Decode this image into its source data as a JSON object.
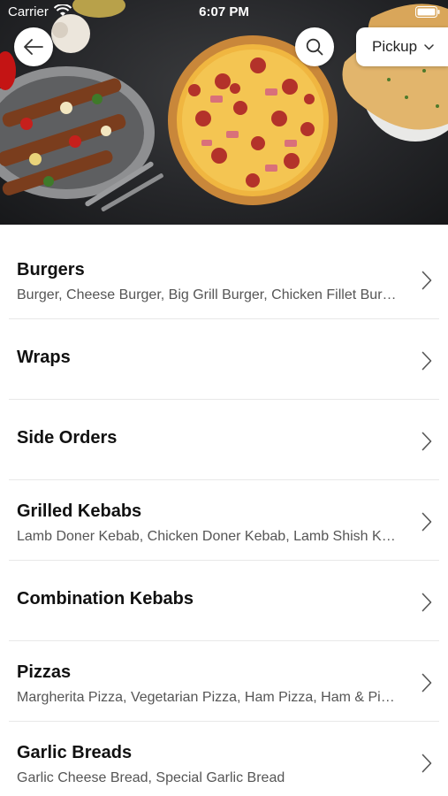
{
  "status_bar": {
    "carrier": "Carrier",
    "time": "6:07 PM"
  },
  "header": {
    "pickup_label": "Pickup"
  },
  "categories": [
    {
      "title": "Burgers",
      "subtitle": "Burger, Cheese Burger, Big Grill Burger, Chicken Fillet Burger"
    },
    {
      "title": "Wraps",
      "subtitle": ""
    },
    {
      "title": "Side Orders",
      "subtitle": ""
    },
    {
      "title": "Grilled Kebabs",
      "subtitle": "Lamb Doner Kebab, Chicken Doner Kebab, Lamb Shish Kebab"
    },
    {
      "title": "Combination Kebabs",
      "subtitle": ""
    },
    {
      "title": "Pizzas",
      "subtitle": "Margherita Pizza, Vegetarian Pizza, Ham Pizza, Ham & Pineapple Pizza"
    },
    {
      "title": "Garlic Breads",
      "subtitle": "Garlic Cheese Bread, Special Garlic Bread"
    }
  ],
  "icons": {
    "back": "arrow-left-icon",
    "search": "search-icon",
    "dropdown": "chevron-down-icon",
    "row": "chevron-right-icon",
    "wifi": "wifi-icon",
    "battery": "battery-icon"
  }
}
